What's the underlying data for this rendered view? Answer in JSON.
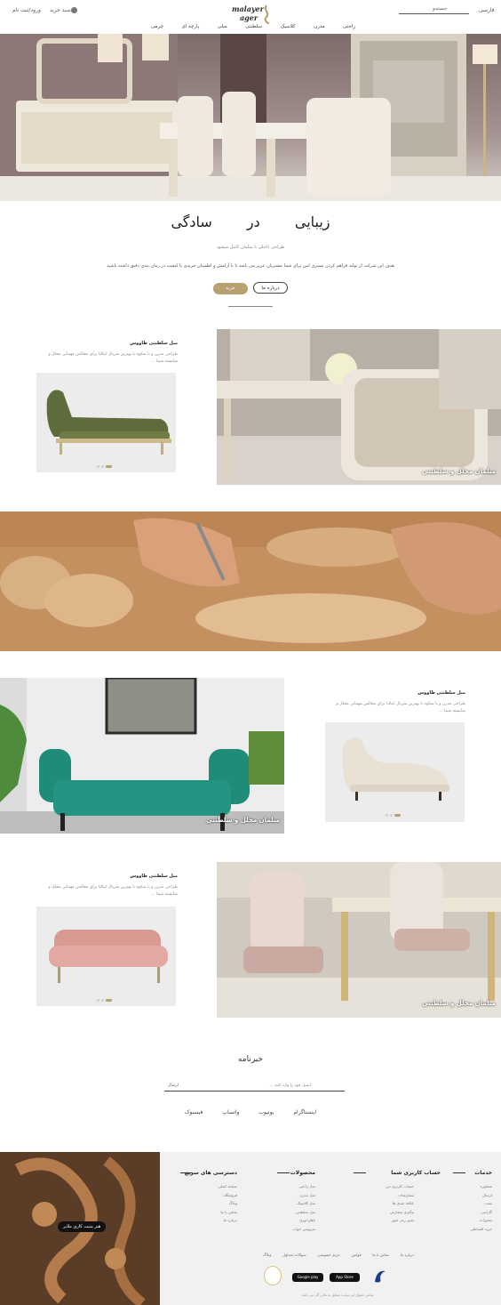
{
  "header": {
    "lang": "فارسی",
    "search_placeholder": "جستجو",
    "logo_top": "malayer",
    "logo_bottom": "ager",
    "cart": "سبد خرید",
    "login": "ورود/ثبت نام",
    "nav": [
      "راحتی",
      "مدرن",
      "کلاسیک",
      "سلطنتی",
      "مبلی",
      "پارچه ای",
      "چرمی"
    ]
  },
  "hero": {
    "title": "زیبایی در سادگی",
    "subtitle": "طراحی داخلی با مبلمان کامل میشود",
    "description": "هدف این شرکت از تولید فراهم کردن بستری امن برای شما مشتریان عزیز می باشد تا با آرامش و اطمینان خریدی با کیفیت در زمان بندی دقیق داشته باشید",
    "about_button": "درباره ما",
    "buy_button": "خرید"
  },
  "products": [
    {
      "title": "مبل سلطنتی طاووس",
      "text": "طراحی مدرن و با شکوه با بهترین متریال ایتالیا برای مجالس مهمانی مجلل و شایسته شما ...",
      "caption": "مبلمان مجلل و سلطنتی"
    },
    {
      "title": "مبل سلطنتی طاووس",
      "text": "طراحی مدرن و با شکوه با بهترین متریال ایتالیا برای مجالس مهمانی مجلل و شایسته شما ...",
      "caption": "مبلمان مجلل و سلطنتی"
    },
    {
      "title": "مبل سلطنتی طاووس",
      "text": "طراحی مدرن و با شکوه با بهترین متریال ایتالیا برای مجالس مهمانی مجلل و شایسته شما ...",
      "caption": "مبلمان مجلل و سلطنتی"
    }
  ],
  "newsletter": {
    "title": "خبرنامه",
    "placeholder": "ایمیل خود را وارد کنید ...",
    "send": "ارسال",
    "social": [
      "اینستاگرام",
      "یوتیوب",
      "واتساپ",
      "فیسبوک"
    ]
  },
  "footer": {
    "art_label": "هنر منبت کاری ملایر",
    "columns": [
      {
        "title": "خدمات",
        "links": [
          "مشاوره",
          "ارسال",
          "نصب",
          "گارانتی",
          "تعمیرات",
          "خرید اقساطی"
        ]
      },
      {
        "title": "حساب کاربری شما",
        "links": [
          "حساب کاربری من",
          "سفارشات",
          "علاقه مندی ها",
          "پیگیری سفارش",
          "تغییر رمز عبور"
        ]
      },
      {
        "title": "محصولات",
        "links": [
          "مبل راحتی",
          "مبل مدرن",
          "مبل کلاسیک",
          "مبل سلطنتی",
          "ناهارخوری",
          "سرویس خواب"
        ]
      },
      {
        "title": "دسترسی های سریع",
        "links": [
          "صفحه اصلی",
          "فروشگاه",
          "وبلاگ",
          "تماس با ما",
          "درباره ما"
        ]
      }
    ],
    "bottom_links": [
      "درباره ما",
      "تماس با ما",
      "قوانین",
      "حریم خصوصی",
      "سوالات متداول",
      "وبلاگ"
    ],
    "badges": [
      "Google play",
      "App Store"
    ],
    "copyright": "تمامی حقوق این سایت متعلق به ملایر آگر می باشد"
  },
  "colors": {
    "accent": "#b9a071",
    "footer_bg": "#f1f1f1",
    "text": "#333333"
  }
}
